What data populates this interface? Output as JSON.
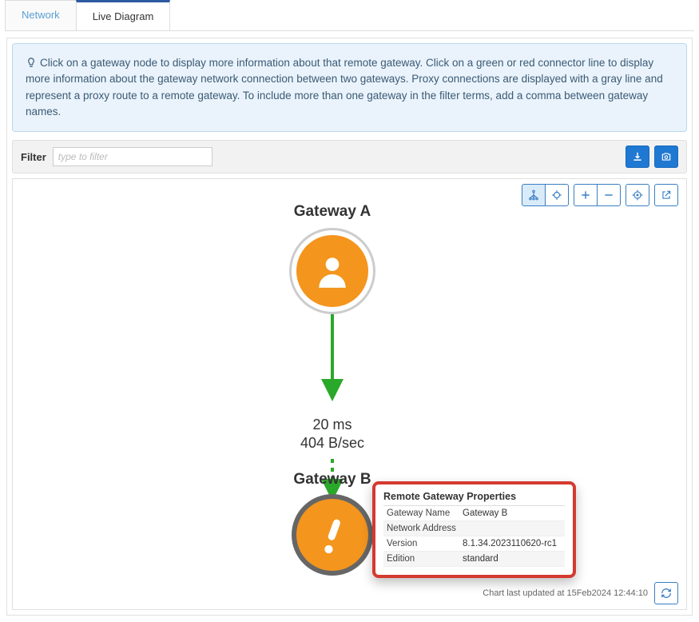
{
  "tabs": {
    "network": "Network",
    "live": "Live Diagram"
  },
  "info_text": "Click on a gateway node to display more information about that remote gateway. Click on a green or red connector line to display more information about the gateway network connection between two gateways. Proxy connections are displayed with a gray line and represent a proxy route to a remote gateway. To include more than one gateway in the filter terms, add a comma between gateway names.",
  "filter": {
    "label": "Filter",
    "placeholder": "type to filter"
  },
  "diagram": {
    "gateway_a_label": "Gateway A",
    "gateway_b_label": "Gateway B",
    "latency": "20 ms",
    "throughput": "404 B/sec"
  },
  "popup": {
    "title": "Remote Gateway Properties",
    "rows": [
      {
        "k": "Gateway Name",
        "v": "Gateway B"
      },
      {
        "k": "Network Address",
        "v": ""
      },
      {
        "k": "Version",
        "v": "8.1.34.2023110620-rc1"
      },
      {
        "k": "Edition",
        "v": "standard"
      }
    ]
  },
  "footer": {
    "last_updated": "Chart last updated at 15Feb2024 12:44:10"
  }
}
